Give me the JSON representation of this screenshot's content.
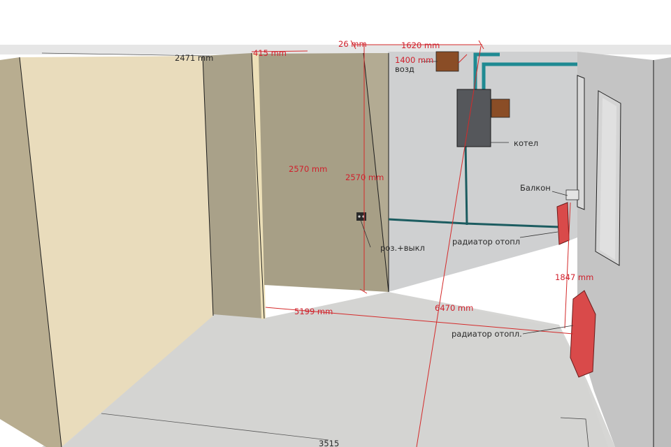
{
  "dimensions": {
    "d_26": "26 mm",
    "d_1620": "1620 mm",
    "d_1400": "1400 mm",
    "d_2471": "2471 mm",
    "d_415": "415 mm",
    "d_2570_a": "2570 mm",
    "d_2570_b": "2570 mm",
    "d_5199": "5199 mm",
    "d_6470": "6470 mm",
    "d_1847": "1847 mm",
    "d_3515": "3515"
  },
  "labels": {
    "vozd": "возд",
    "kotel": "котел",
    "balkon": "Балкон",
    "rozetka": "роз.+выкл",
    "radiator_1": "радиатор отопл",
    "radiator_2": "радиатор отопл."
  },
  "colors": {
    "background": "#ffffff",
    "floor": "#d6d6d4",
    "back_wall": "#cfd0d1",
    "right_wall": "#c6c6c6",
    "partition_light": "#e9dcbc",
    "partition_dark": "#a8a088",
    "boiler": "#55575b",
    "pipe": "#1f8a92",
    "radiator": "#d94a4a",
    "vent_box": "#8a4d26",
    "dimension": "#d0202c"
  }
}
